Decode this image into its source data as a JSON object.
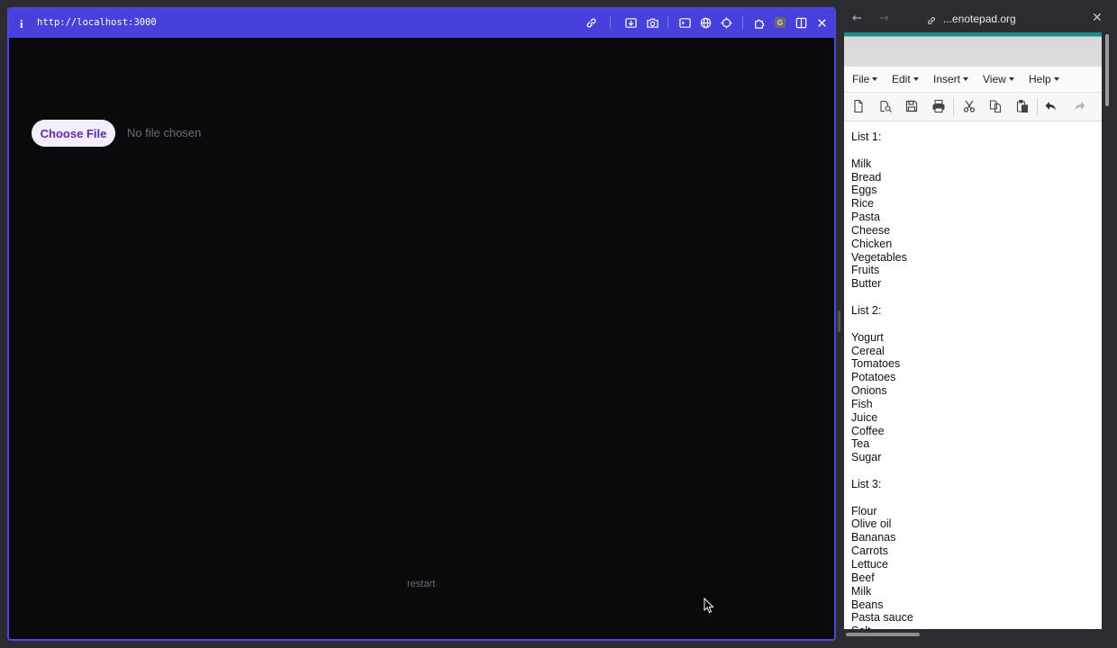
{
  "left_browser": {
    "info_glyph": "i",
    "url": "http://localhost:3000",
    "toolbar_icons": [
      "link-icon",
      "screenshot-icon",
      "camera-icon",
      "terminal-icon",
      "globe-icon",
      "crosshair-icon",
      "extension-icon",
      "profile-badge-icon",
      "split-view-icon",
      "close-icon"
    ],
    "profile_badge": "G",
    "file_input": {
      "button_label": "Choose File",
      "status": "No file chosen"
    },
    "restart_label": "restart"
  },
  "right_browser": {
    "url": "...enotepad.org",
    "menu": [
      "File",
      "Edit",
      "Insert",
      "View",
      "Help"
    ],
    "toolbar_icons": [
      "new-doc-icon",
      "open-icon",
      "save-icon",
      "print-icon",
      "cut-icon",
      "copy-icon",
      "paste-icon",
      "undo-icon",
      "redo-icon"
    ],
    "document_lines": [
      "List 1:",
      "",
      "Milk",
      "Bread",
      "Eggs",
      "Rice",
      "Pasta",
      "Cheese",
      "Chicken",
      "Vegetables",
      "Fruits",
      "Butter",
      "",
      "List 2:",
      "",
      "Yogurt",
      "Cereal",
      "Tomatoes",
      "Potatoes",
      "Onions",
      "Fish",
      "Juice",
      "Coffee",
      "Tea",
      "Sugar",
      "",
      "List 3:",
      "",
      "Flour",
      "Olive oil",
      "Bananas",
      "Carrots",
      "Lettuce",
      "Beef",
      "Milk",
      "Beans",
      "Pasta sauce",
      "Salt"
    ]
  },
  "colors": {
    "left_bar": "#4840dd",
    "choose_file_text": "#5b2bb6",
    "notepad_banner": "#1f8c8c"
  }
}
